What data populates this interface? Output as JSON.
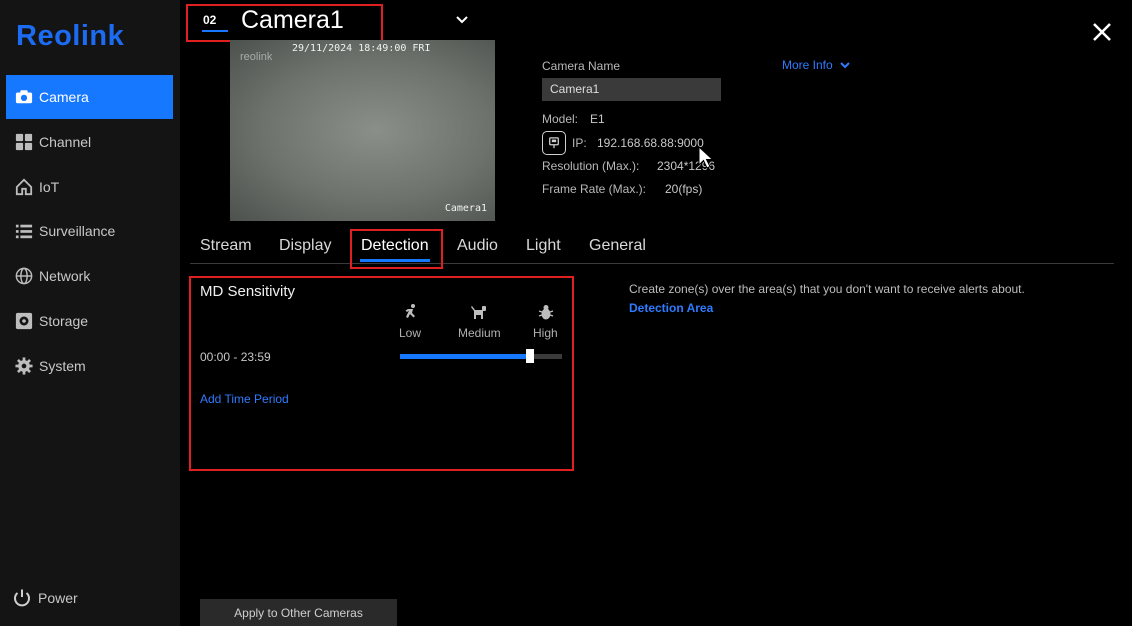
{
  "app": {
    "logo": "Reolink"
  },
  "sidebar": {
    "items": [
      {
        "label": "Camera",
        "icon": "camera-icon",
        "active": true
      },
      {
        "label": "Channel",
        "icon": "grid-icon"
      },
      {
        "label": "IoT",
        "icon": "home-icon"
      },
      {
        "label": "Surveillance",
        "icon": "list-icon"
      },
      {
        "label": "Network",
        "icon": "globe-icon"
      },
      {
        "label": "Storage",
        "icon": "storage-icon"
      },
      {
        "label": "System",
        "icon": "gear-icon"
      }
    ],
    "power_label": "Power"
  },
  "header": {
    "channel_number": "02",
    "camera_title": "Camera1"
  },
  "preview": {
    "timestamp": "29/11/2024 18:49:00 FRI",
    "watermark": "reolink",
    "camera_label": "Camera1"
  },
  "info": {
    "camera_name_label": "Camera Name",
    "camera_name_value": "Camera1",
    "more_info": "More Info",
    "model_label": "Model:",
    "model_value": "E1",
    "ip_label": "IP:",
    "ip_value": "192.168.68.88:9000",
    "resolution_label": "Resolution (Max.):",
    "resolution_value": "2304*1296",
    "framerate_label": "Frame Rate (Max.):",
    "framerate_value": "20(fps)"
  },
  "tabs": [
    {
      "label": "Stream"
    },
    {
      "label": "Display"
    },
    {
      "label": "Detection",
      "active": true
    },
    {
      "label": "Audio"
    },
    {
      "label": "Light"
    },
    {
      "label": "General"
    }
  ],
  "md": {
    "title": "MD Sensitivity",
    "levels": [
      "Low",
      "Medium",
      "High"
    ],
    "time_range": "00:00 - 23:59",
    "sensitivity_fraction": 0.8,
    "add_time_period": "Add Time Period"
  },
  "detection_area": {
    "description": "Create zone(s) over the area(s) that you don't want to receive alerts about.",
    "link": "Detection Area"
  },
  "footer": {
    "apply_button": "Apply to Other Cameras"
  },
  "colors": {
    "accent": "#1677ff",
    "highlight_box": "#e02020",
    "sidebar_bg": "#141414"
  }
}
